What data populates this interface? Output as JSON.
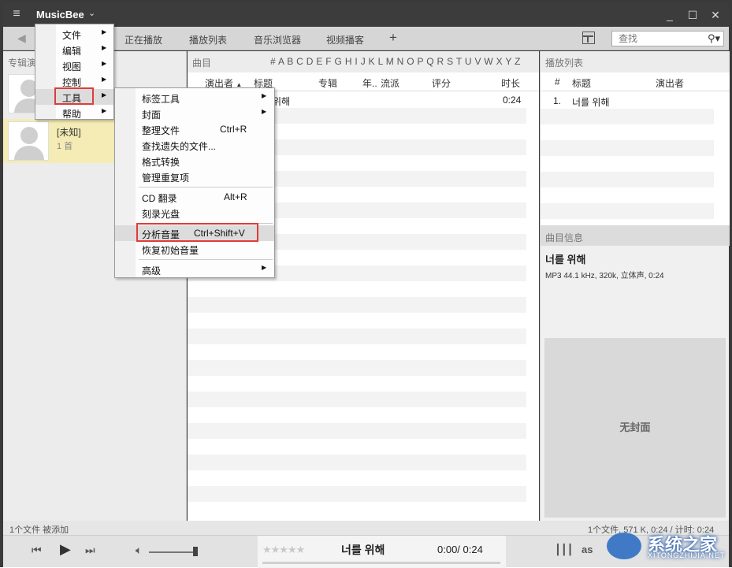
{
  "app": {
    "name": "MusicBee"
  },
  "tabs": [
    "正在播放",
    "播放列表",
    "音乐浏览器",
    "视频播客"
  ],
  "search": {
    "placeholder": "查找"
  },
  "left": {
    "header": "专辑演",
    "artists": [
      {
        "name": "",
        "count": ""
      },
      {
        "name": "[未知]",
        "count": "1 首"
      }
    ]
  },
  "middle": {
    "title": "曲目",
    "alphabet": "# A B C D E F G H I  J K L M N O P Q R S T U V W X Y Z",
    "columns": [
      "演出者",
      "标题",
      "专辑",
      "年..",
      "流派",
      "评分",
      "时长"
    ],
    "rows": [
      {
        "title": "위해",
        "duration": "0:24"
      }
    ]
  },
  "right": {
    "title": "播放列表",
    "columns": [
      "#",
      "标题",
      "演出者"
    ],
    "tracks": [
      {
        "num": "1.",
        "title": "너를 위해"
      }
    ],
    "info_title": "曲目信息",
    "info_song": "너를 위해",
    "info_meta": "MP3 44.1 kHz, 320k, 立体声, 0:24",
    "no_cover": "无封面"
  },
  "status": {
    "left": "1个文件 被添加",
    "right": "1个文件, 571 K, 0:24 / 计时: 0:24"
  },
  "player": {
    "song": "너를 위해",
    "time": "0:00/ 0:24",
    "stars": "★★★★★"
  },
  "main_menu": [
    {
      "label": "文件"
    },
    {
      "label": "编辑"
    },
    {
      "label": "视图"
    },
    {
      "label": "控制"
    },
    {
      "label": "工具"
    },
    {
      "label": "帮助"
    }
  ],
  "tools_menu": [
    {
      "label": "标签工具",
      "shortcut": ""
    },
    {
      "label": "封面",
      "shortcut": ""
    },
    {
      "label": "整理文件",
      "shortcut": "Ctrl+R"
    },
    {
      "label": "查找遗失的文件...",
      "shortcut": ""
    },
    {
      "label": "格式转换",
      "shortcut": ""
    },
    {
      "label": "管理重复项",
      "shortcut": ""
    },
    {
      "label": "CD 翻录",
      "shortcut": "Alt+R"
    },
    {
      "label": "刻录光盘",
      "shortcut": ""
    },
    {
      "label": "分析音量",
      "shortcut": "Ctrl+Shift+V"
    },
    {
      "label": "恢复初始音量",
      "shortcut": ""
    },
    {
      "label": "高级",
      "shortcut": ""
    }
  ],
  "watermark": {
    "text": "系统之家",
    "sub": "XITONGZHIJIA.NET"
  }
}
